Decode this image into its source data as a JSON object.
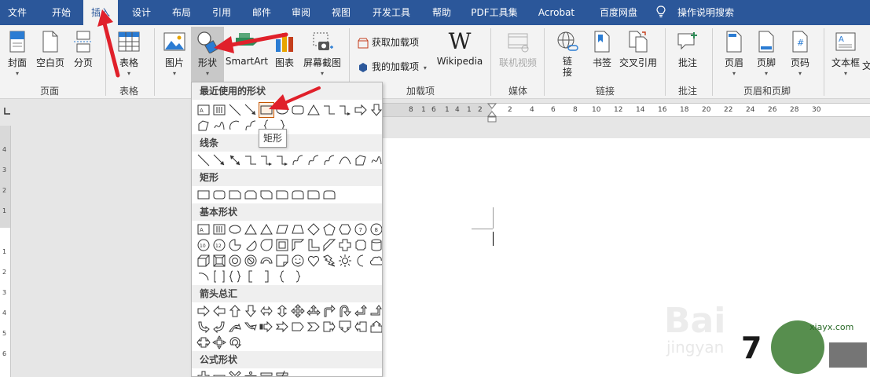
{
  "tabs": [
    "文件",
    "开始",
    "插入",
    "设计",
    "布局",
    "引用",
    "邮件",
    "审阅",
    "视图",
    "开发工具",
    "帮助",
    "PDF工具集",
    "Acrobat",
    "百度网盘",
    "操作说明搜索"
  ],
  "ribbon": {
    "pages_group": {
      "label": "页面",
      "cover": "封面",
      "blank": "空白页",
      "break": "分页"
    },
    "table_group": {
      "label": "表格",
      "table": "表格"
    },
    "illust": {
      "picture": "图片",
      "shapes": "形状",
      "smartart": "SmartArt",
      "chart": "图表",
      "screenshot": "屏幕截图"
    },
    "addins": {
      "label": "加载项",
      "get": "获取加载项",
      "my": "我的加载项",
      "wikipedia": "Wikipedia"
    },
    "media": {
      "label": "媒体",
      "online_video": "联机视频"
    },
    "links": {
      "label": "链接",
      "link": "链\n接",
      "bookmark": "书签",
      "crossref": "交叉引用"
    },
    "comments": {
      "label": "批注",
      "comment": "批注"
    },
    "headerfooter": {
      "label": "页眉和页脚",
      "header": "页眉",
      "footer": "页脚",
      "pagenum": "页码"
    },
    "text": {
      "textbox": "文本框",
      "more": "文"
    }
  },
  "ruler": {
    "h_ticks": [
      "8",
      "1",
      "6",
      "1",
      "4",
      "1",
      "2",
      "",
      "2",
      "4",
      "6",
      "8",
      "10",
      "12",
      "14",
      "16",
      "18",
      "20",
      "22",
      "24",
      "26",
      "28",
      "30"
    ],
    "v_ticks": [
      "4",
      "3",
      "2",
      "1",
      "",
      "1",
      "2",
      "3",
      "4",
      "5",
      "6",
      "7",
      "8"
    ]
  },
  "dropdown": {
    "sections": {
      "recent": "最近使用的形状",
      "lines": "线条",
      "rect": "矩形",
      "basic": "基本形状",
      "arrows": "箭头总汇",
      "formula": "公式形状"
    },
    "tooltip": "矩形"
  },
  "watermark": {
    "baidu": "Bai",
    "jingyan": "jingyan",
    "site": "xiayx.com"
  },
  "colors": {
    "accent": "#2b579a",
    "arrow": "#e0202a"
  }
}
